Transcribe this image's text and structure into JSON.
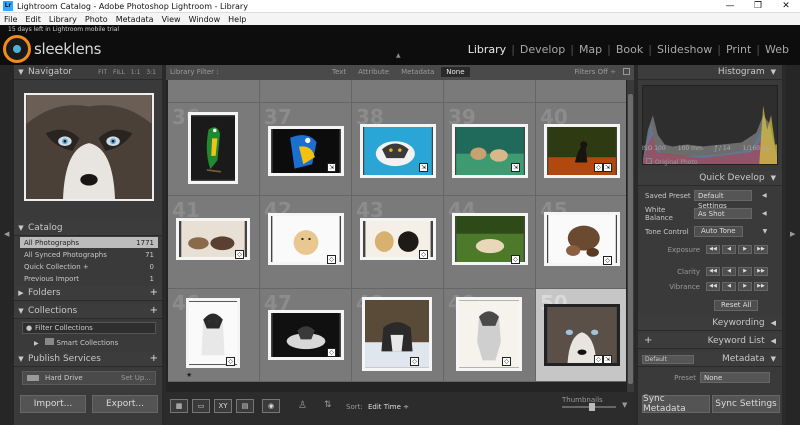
{
  "window": {
    "title": "Lightroom Catalog - Adobe Photoshop Lightroom - Library",
    "app_icon_label": "Lr",
    "minimize": "—",
    "maximize": "❐",
    "close": "✕"
  },
  "menu": [
    "File",
    "Edit",
    "Library",
    "Photo",
    "Metadata",
    "View",
    "Window",
    "Help"
  ],
  "identity": {
    "trial_text": "15 days left in Lightroom mobile trial",
    "brand": "sleeklens"
  },
  "modules": [
    {
      "label": "Library",
      "active": true
    },
    {
      "label": "Develop"
    },
    {
      "label": "Map"
    },
    {
      "label": "Book"
    },
    {
      "label": "Slideshow"
    },
    {
      "label": "Print"
    },
    {
      "label": "Web"
    }
  ],
  "left_panel": {
    "navigator": {
      "title": "Navigator",
      "zoom": [
        "FIT",
        "FILL",
        "1:1",
        "3:1"
      ]
    },
    "catalog": {
      "title": "Catalog",
      "items": [
        {
          "label": "All Photographs",
          "count": "1771",
          "selected": true
        },
        {
          "label": "All Synced Photographs",
          "count": "71"
        },
        {
          "label": "Quick Collection  +",
          "count": "0"
        },
        {
          "label": "Previous Import",
          "count": "1"
        }
      ]
    },
    "folders": {
      "title": "Folders"
    },
    "collections": {
      "title": "Collections",
      "filter": "Filter Collections",
      "smart": "Smart Collections"
    },
    "publish": {
      "title": "Publish Services",
      "hard_drive": "Hard Drive",
      "setup": "Set Up..."
    },
    "import_label": "Import...",
    "export_label": "Export..."
  },
  "library_filter": {
    "label": "Library Filter :",
    "tabs": [
      {
        "label": "Text"
      },
      {
        "label": "Attribute"
      },
      {
        "label": "Metadata"
      },
      {
        "label": "None",
        "active": true
      }
    ],
    "filters_off": "Filters Off ÷"
  },
  "grid": {
    "rows": [
      {
        "numbers": [
          "",
          "",
          "",
          "",
          ""
        ]
      },
      {
        "numbers": [
          "36",
          "37",
          "38",
          "39",
          "40"
        ]
      },
      {
        "numbers": [
          "41",
          "42",
          "43",
          "44",
          "45"
        ]
      },
      {
        "numbers": [
          "46",
          "47",
          "48",
          "49",
          "50"
        ]
      }
    ],
    "selected_cell": "50"
  },
  "toolbar": {
    "sort_label": "Sort:",
    "sort_value": "Edit Time ÷",
    "thumbnails_label": "Thumbnails"
  },
  "right_panel": {
    "histogram": {
      "title": "Histogram",
      "iso": "ISO 100",
      "focal": "100 mm",
      "aperture": "ƒ / 14",
      "shutter": "1/160 sec",
      "original_photo": "Original Photo"
    },
    "quick_develop": {
      "title": "Quick Develop",
      "saved_preset_label": "Saved Preset",
      "saved_preset_value": "Default Settings",
      "white_balance_label": "White Balance",
      "white_balance_value": "As Shot",
      "tone_control_label": "Tone Control",
      "auto_tone": "Auto Tone",
      "exposure": "Exposure",
      "clarity": "Clarity",
      "vibrance": "Vibrance",
      "reset_all": "Reset All"
    },
    "keywording": {
      "title": "Keywording"
    },
    "keyword_list": {
      "title": "Keyword List"
    },
    "metadata": {
      "title": "Metadata",
      "default": "Default",
      "preset_label": "Preset",
      "preset_value": "None"
    },
    "sync_metadata": "Sync Metadata",
    "sync_settings": "Sync Settings"
  },
  "colors": {
    "brand_orange": "#f08c1e",
    "panel": "#3a3a3a",
    "grid_cell": "#7a7a7a",
    "selected_cell": "#c6c6c6"
  }
}
